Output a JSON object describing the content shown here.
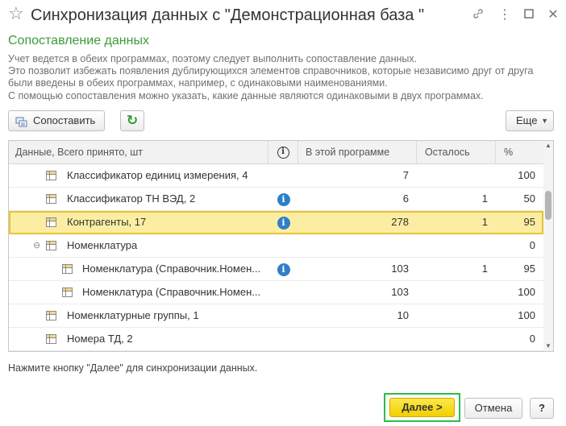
{
  "window": {
    "title": "Синхронизация данных с \"Демонстрационная база \"",
    "favorite_icon": "star-icon",
    "link_icon": "link-icon",
    "maximize_icon": "maximize-icon",
    "close_icon": "close-icon"
  },
  "header": {
    "section_title": "Сопоставление данных",
    "description": [
      "Учет ведется в обеих программах, поэтому следует выполнить сопоставление данных.",
      "Это позволит избежать появления дублирующихся элементов справочников, которые независимо друг от друга",
      "были введены в обеих программах, например, с одинаковыми наименованиями.",
      "С помощью сопоставления можно указать, какие данные являются одинаковыми в двух программах."
    ]
  },
  "toolbar": {
    "match_label": "Сопоставить",
    "refresh_icon": "refresh-icon",
    "more_label": "Еще"
  },
  "table": {
    "columns": {
      "name": "Данные, Всего принято, шт",
      "info": "i",
      "this_program": "В этой программе",
      "remaining": "Осталось",
      "percent": "%"
    },
    "rows": [
      {
        "name": "Классификатор единиц измерения, 4",
        "info": "",
        "this_program": "7",
        "remaining": "",
        "percent": "100"
      },
      {
        "name": "Классификатор ТН ВЭД, 2",
        "info": "i",
        "this_program": "6",
        "remaining": "1",
        "percent": "50"
      },
      {
        "name": "Контрагенты, 17",
        "info": "i",
        "this_program": "278",
        "remaining": "1",
        "percent": "95"
      },
      {
        "name": "Номенклатура",
        "info": "",
        "this_program": "",
        "remaining": "",
        "percent": "0",
        "expander": "⊖"
      },
      {
        "name": "Номенклатура (Справочник.Номен...",
        "info": "i",
        "this_program": "103",
        "remaining": "1",
        "percent": "95"
      },
      {
        "name": "Номенклатура (Справочник.Номен...",
        "info": "",
        "this_program": "103",
        "remaining": "",
        "percent": "100"
      },
      {
        "name": "Номенклатурные группы, 1",
        "info": "",
        "this_program": "10",
        "remaining": "",
        "percent": "100"
      },
      {
        "name": "Номера ТД, 2",
        "info": "",
        "this_program": "",
        "remaining": "",
        "percent": "0"
      }
    ]
  },
  "footer": {
    "hint": "Нажмите кнопку \"Далее\" для синхронизации данных.",
    "next_label": "Далее >",
    "cancel_label": "Отмена",
    "help_label": "?"
  },
  "colors": {
    "accent_green": "#3d9b39",
    "selection": "#fbeea3",
    "primary_button": "#fde84a",
    "info_blue": "#2f7fc8"
  }
}
